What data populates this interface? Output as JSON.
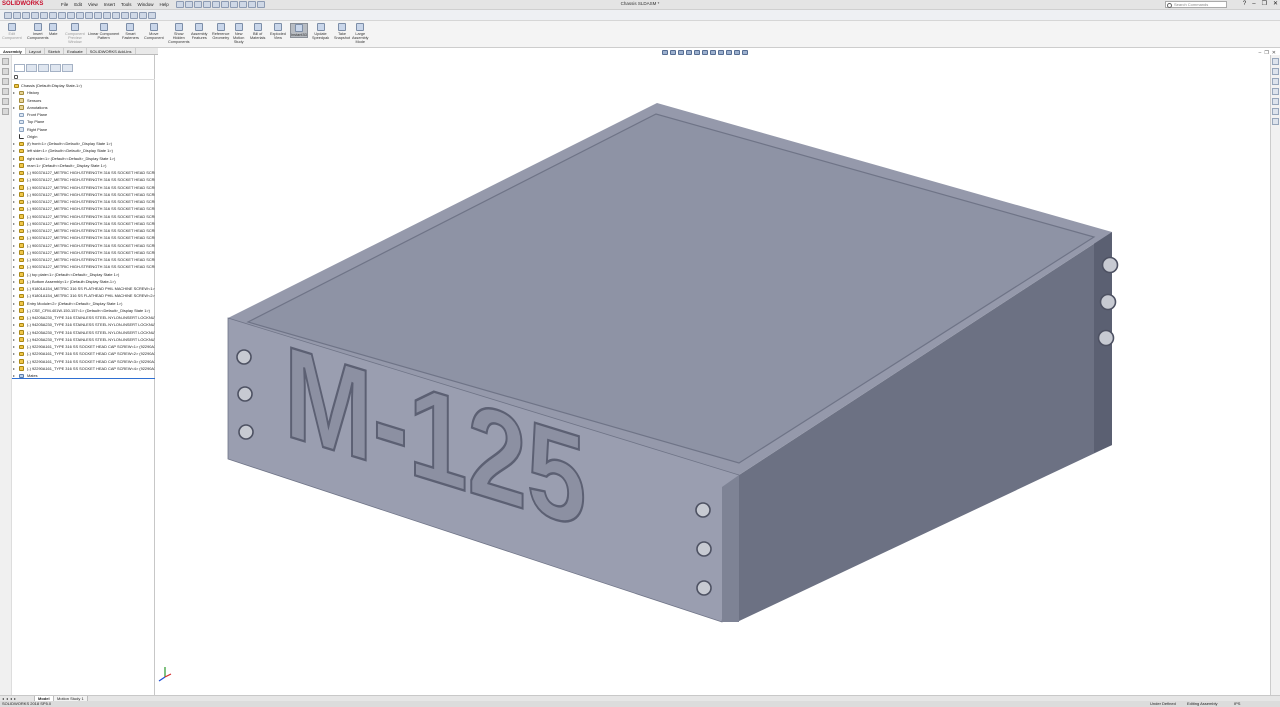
{
  "app": {
    "brand": "SOLIDWORKS",
    "document_title": "Chassis SLDASM *"
  },
  "menu": [
    "File",
    "Edit",
    "View",
    "Insert",
    "Tools",
    "Window",
    "Help"
  ],
  "search": {
    "placeholder": "Search Commands"
  },
  "window_controls": {
    "help": "?",
    "minimize": "–",
    "restore": "❐",
    "close": "✕"
  },
  "ribbon": [
    {
      "label": "Edit\nComponent",
      "dim": true
    },
    {
      "label": "Insert\nComponents",
      "dim": false
    },
    {
      "label": "Mate",
      "dim": false
    },
    {
      "label": "Component\nPreview\nWindow",
      "dim": true
    },
    {
      "label": "Linear Component\nPattern",
      "dim": false
    },
    {
      "label": "Smart\nFasteners",
      "dim": false
    },
    {
      "label": "Move\nComponent",
      "dim": false
    },
    {
      "label": "Show\nHidden\nComponents",
      "dim": false
    },
    {
      "label": "Assembly\nFeatures",
      "dim": false
    },
    {
      "label": "Reference\nGeometry",
      "dim": false
    },
    {
      "label": "New\nMotion\nStudy",
      "dim": false
    },
    {
      "label": "Bill of\nMaterials",
      "dim": false
    },
    {
      "label": "Exploded\nView",
      "dim": false
    },
    {
      "label": "Instant3D",
      "dim": false,
      "active": true
    },
    {
      "label": "Update\nSpeedpak",
      "dim": false
    },
    {
      "label": "Take\nSnapshot",
      "dim": false
    },
    {
      "label": "Large\nAssembly\nMode",
      "dim": false
    }
  ],
  "command_tabs": [
    "Assembly",
    "Layout",
    "Sketch",
    "Evaluate",
    "SOLIDWORKS Add-Ins"
  ],
  "tree": {
    "items": [
      {
        "text": "Chassis  (Default<Display State-1>)",
        "kind": "root",
        "exp": ""
      },
      {
        "text": "History",
        "kind": "folder",
        "exp": "▸"
      },
      {
        "text": "Sensors",
        "kind": "folder",
        "exp": ""
      },
      {
        "text": "Annotations",
        "kind": "folder",
        "exp": "▸"
      },
      {
        "text": "Front Plane",
        "kind": "plane",
        "exp": ""
      },
      {
        "text": "Top Plane",
        "kind": "plane",
        "exp": ""
      },
      {
        "text": "Right Plane",
        "kind": "plane",
        "exp": ""
      },
      {
        "text": "Origin",
        "kind": "origin",
        "exp": ""
      },
      {
        "text": "(f) front<1> (Default<<Default>_Display State 1>)",
        "kind": "part",
        "exp": "▸"
      },
      {
        "text": "left side<1> (Default<<Default>_Display State 1>)",
        "kind": "part",
        "exp": "▸"
      },
      {
        "text": "right side<1> (Default<<Default>_Display State 1>)",
        "kind": "part",
        "exp": "▸"
      },
      {
        "text": "rear<1> (Default<<Default>_Display State 1>)",
        "kind": "part",
        "exp": "▸"
      },
      {
        "text": "(-) 90037A127_METRIC HIGH-STRENGTH 316 SS SOCKET HEAD SCREW<1>",
        "kind": "part",
        "exp": "▸"
      },
      {
        "text": "(-) 90037A127_METRIC HIGH-STRENGTH 316 SS SOCKET HEAD SCREW<2>",
        "kind": "part",
        "exp": "▸"
      },
      {
        "text": "(-) 90037A127_METRIC HIGH-STRENGTH 316 SS SOCKET HEAD SCREW<3>",
        "kind": "part",
        "exp": "▸"
      },
      {
        "text": "(-) 90037A127_METRIC HIGH-STRENGTH 316 SS SOCKET HEAD SCREW<4>",
        "kind": "part",
        "exp": "▸"
      },
      {
        "text": "(-) 90037A127_METRIC HIGH-STRENGTH 316 SS SOCKET HEAD SCREW<5>",
        "kind": "part",
        "exp": "▸"
      },
      {
        "text": "(-) 90037A127_METRIC HIGH-STRENGTH 316 SS SOCKET HEAD SCREW<6>",
        "kind": "part",
        "exp": "▸"
      },
      {
        "text": "(-) 90037A127_METRIC HIGH-STRENGTH 316 SS SOCKET HEAD SCREW<7>",
        "kind": "part",
        "exp": "▸"
      },
      {
        "text": "(-) 90037A127_METRIC HIGH-STRENGTH 316 SS SOCKET HEAD SCREW<8>",
        "kind": "part",
        "exp": "▸"
      },
      {
        "text": "(-) 90037A127_METRIC HIGH-STRENGTH 316 SS SOCKET HEAD SCREW<9>",
        "kind": "part",
        "exp": "▸"
      },
      {
        "text": "(-) 90037A127_METRIC HIGH-STRENGTH 316 SS SOCKET HEAD SCREW<10>",
        "kind": "part",
        "exp": "▸"
      },
      {
        "text": "(-) 90037A127_METRIC HIGH-STRENGTH 316 SS SOCKET HEAD SCREW<11>",
        "kind": "part",
        "exp": "▸"
      },
      {
        "text": "(-) 90037A127_METRIC HIGH-STRENGTH 316 SS SOCKET HEAD SCREW<12>",
        "kind": "part",
        "exp": "▸"
      },
      {
        "text": "(-) 90037A127_METRIC HIGH-STRENGTH 316 SS SOCKET HEAD SCREW<13>",
        "kind": "part",
        "exp": "▸"
      },
      {
        "text": "(-) 90037A127_METRIC HIGH-STRENGTH 316 SS SOCKET HEAD SCREW<14>",
        "kind": "part",
        "exp": "▸"
      },
      {
        "text": "(-) top plate<1> (Default<<Default>_Display State 1>)",
        "kind": "part",
        "exp": "▸"
      },
      {
        "text": "(-) Bottom Assembly<1> (Default<Display State-1>)",
        "kind": "part",
        "exp": "▸"
      },
      {
        "text": "(-) 91801A154_METRIC 316 SS FLATHEAD PHIL MACHINE SCREW<1> (0",
        "kind": "part",
        "exp": "▸"
      },
      {
        "text": "(-) 91801A154_METRIC 316 SS FLATHEAD PHIL MACHINE SCREW<2> (0",
        "kind": "part",
        "exp": "▸"
      },
      {
        "text": "Entry Module<2> (Default<<Default>_Display State 1>)",
        "kind": "part",
        "exp": "▸"
      },
      {
        "text": "(-) CSE_CFM-401W-150-157<1> (Default<<Default>_Display State 1>)",
        "kind": "part",
        "exp": "▸"
      },
      {
        "text": "(-) 94205A230_TYPE 316 STAINLESS STEEL NYLON-INSERT LOCKNUT<1>",
        "kind": "part",
        "exp": "▸"
      },
      {
        "text": "(-) 94205A230_TYPE 316 STAINLESS STEEL NYLON-INSERT LOCKNUT<2>",
        "kind": "part",
        "exp": "▸"
      },
      {
        "text": "(-) 94205A230_TYPE 316 STAINLESS STEEL NYLON-INSERT LOCKNUT<3>",
        "kind": "part",
        "exp": "▸"
      },
      {
        "text": "(-) 94205A230_TYPE 316 STAINLESS STEEL NYLON-INSERT LOCKNUT<4>",
        "kind": "part",
        "exp": "▸"
      },
      {
        "text": "(-) 92290A161_TYPE 316 SS SOCKET HEAD CAP SCREW<1> (92290A161<",
        "kind": "part",
        "exp": "▸"
      },
      {
        "text": "(-) 92290A161_TYPE 316 SS SOCKET HEAD CAP SCREW<2> (92290A161<",
        "kind": "part",
        "exp": "▸"
      },
      {
        "text": "(-) 92290A161_TYPE 316 SS SOCKET HEAD CAP SCREW<3> (92290A161<",
        "kind": "part",
        "exp": "▸"
      },
      {
        "text": "(-) 92290A161_TYPE 316 SS SOCKET HEAD CAP SCREW<4> (92290A161<",
        "kind": "part",
        "exp": "▸"
      },
      {
        "text": "Mates",
        "kind": "mates",
        "exp": "▸"
      }
    ]
  },
  "model": {
    "engraving": "M-125",
    "body_color": "#9498aa"
  },
  "bottom_tabs": [
    "Model",
    "Motion Study 1"
  ],
  "status": {
    "version": "SOLIDWORKS 2018 SP5.0",
    "state": "Under Defined",
    "mode": "Editing Assembly",
    "units": "IPS"
  }
}
